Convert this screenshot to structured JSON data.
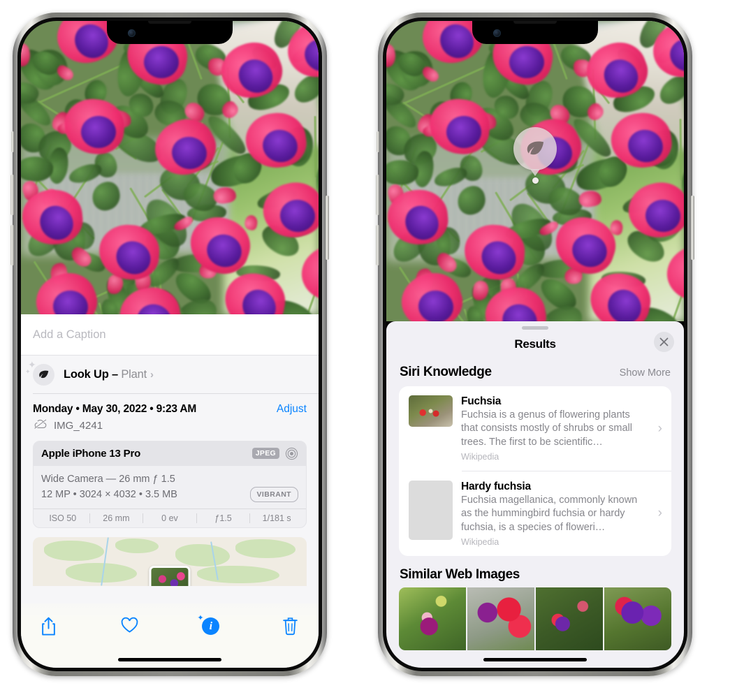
{
  "left_phone": {
    "caption": {
      "placeholder": "Add a Caption",
      "value": ""
    },
    "lookup": {
      "label": "Look Up – ",
      "subject": "Plant",
      "chevron": "›",
      "icon": "leaf-icon"
    },
    "date": {
      "text": "Monday • May 30, 2022 • 9:23 AM",
      "adjust_label": "Adjust"
    },
    "file": {
      "name": "IMG_4241",
      "icon": "icloud-slash-icon"
    },
    "metadata": {
      "device": "Apple iPhone 13 Pro",
      "format_badge": "JPEG",
      "lens_icon": "aperture-icon",
      "lens_line": "Wide Camera — 26 mm ƒ 1.5",
      "size_line": "12 MP • 3024 × 4032 • 3.5 MB",
      "style_badge": "VIBRANT",
      "exif": [
        "ISO 50",
        "26 mm",
        "0 ev",
        "ƒ1.5",
        "1/181 s"
      ]
    },
    "toolbar": [
      {
        "name": "share-button",
        "icon": "share-icon"
      },
      {
        "name": "favorite-button",
        "icon": "heart-icon"
      },
      {
        "name": "info-button",
        "icon": "info-sparkle-icon"
      },
      {
        "name": "delete-button",
        "icon": "trash-icon"
      }
    ]
  },
  "right_phone": {
    "pin": {
      "icon": "leaf-icon"
    },
    "sheet": {
      "title": "Results",
      "close_icon": "close-icon",
      "siri_knowledge": {
        "heading": "Siri Knowledge",
        "show_more": "Show More",
        "items": [
          {
            "title": "Fuchsia",
            "description": "Fuchsia is a genus of flowering plants that consists mostly of shrubs or small trees. The first to be scientific…",
            "source": "Wikipedia",
            "chevron": "›"
          },
          {
            "title": "Hardy fuchsia",
            "description": "Fuchsia magellanica, commonly known as the hummingbird fuchsia or hardy fuchsia, is a species of floweri…",
            "source": "Wikipedia",
            "chevron": "›"
          }
        ]
      },
      "similar_web_images": {
        "heading": "Similar Web Images",
        "count": 4
      }
    }
  },
  "colors": {
    "accent": "#0a84ff",
    "sheet_bg": "#f1f0f5",
    "muted_text": "#86868c"
  }
}
